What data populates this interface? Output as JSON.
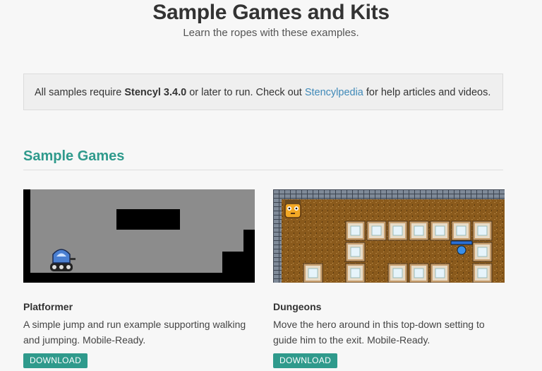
{
  "header": {
    "title": "Sample Games and Kits",
    "subtitle": "Learn the ropes with these examples."
  },
  "notice": {
    "prefix": "All samples require ",
    "version": "Stencyl 3.4.0",
    "middle": " or later to run. Check out ",
    "link_text": "Stencylpedia",
    "suffix": " for help articles and videos."
  },
  "section": {
    "title": "Sample Games"
  },
  "games": [
    {
      "title": "Platformer",
      "description": "A simple jump and run example supporting walking and jumping. Mobile-Ready.",
      "button_label": "DOWNLOAD"
    },
    {
      "title": "Dungeons",
      "description": "Move the hero around in this top-down setting to guide him to the exit. Mobile-Ready.",
      "button_label": "DOWNLOAD"
    }
  ],
  "colors": {
    "accent": "#2f9a8c",
    "link": "#3f89b8"
  }
}
